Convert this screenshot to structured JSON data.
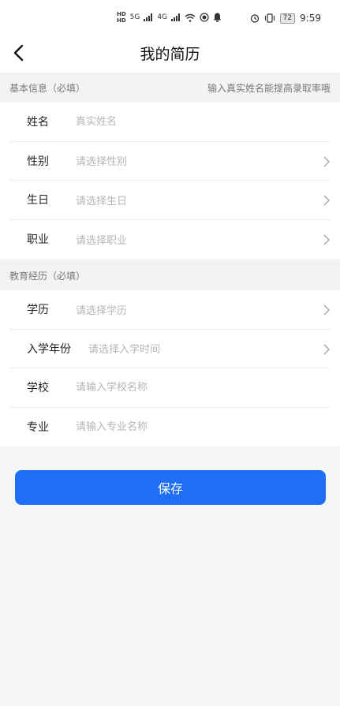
{
  "status_bar": {
    "hd_top": "HD",
    "hd_bottom": "HD",
    "net_5g": "5G",
    "net_4g": "4G",
    "battery": "72",
    "time": "9:59"
  },
  "header": {
    "title": "我的简历"
  },
  "basic_section": {
    "title": "基本信息（必填）",
    "hint": "输入真实姓名能提高录取率哦",
    "fields": [
      {
        "label": "姓名",
        "placeholder": "真实姓名",
        "value": ""
      },
      {
        "label": "性别",
        "placeholder": "请选择性别"
      },
      {
        "label": "生日",
        "placeholder": "请选择生日"
      },
      {
        "label": "职业",
        "placeholder": "请选择职业"
      }
    ]
  },
  "education_section": {
    "title": "教育经历（必填）",
    "fields": [
      {
        "label": "学历",
        "placeholder": "请选择学历"
      },
      {
        "label": "入学年份",
        "placeholder": "请选择入学时间"
      },
      {
        "label": "学校",
        "placeholder": "请输入学校名称",
        "value": ""
      },
      {
        "label": "专业",
        "placeholder": "请输入专业名称",
        "value": ""
      }
    ]
  },
  "save_button": {
    "label": "保存"
  },
  "colors": {
    "primary": "#1e6ff5",
    "background": "#f5f6f8",
    "placeholder": "#b5b5b5"
  }
}
